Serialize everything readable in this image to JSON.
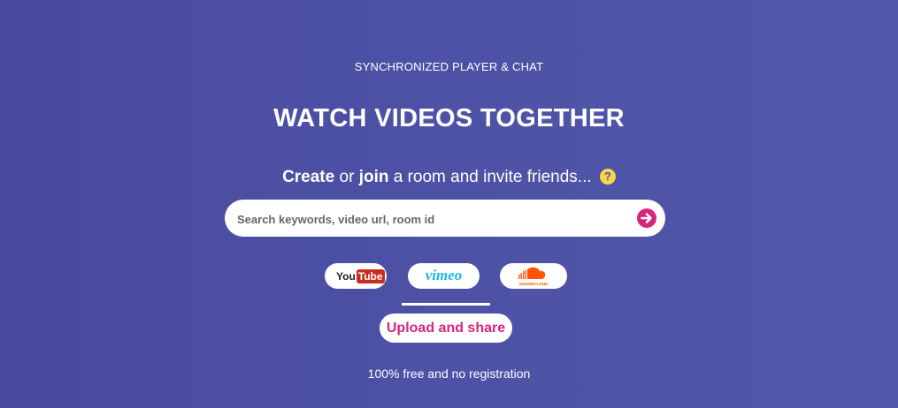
{
  "hero": {
    "eyebrow": "SYNCHRONIZED PLAYER & CHAT",
    "title": "WATCH VIDEOS TOGETHER",
    "subline": {
      "create": "Create",
      "or": "or",
      "join": "join",
      "rest": "a room and invite friends...",
      "help_glyph": "?"
    }
  },
  "search": {
    "placeholder": "Search keywords, video url, room id",
    "value": "",
    "submit_icon": "arrow-right-circle-icon"
  },
  "providers": [
    {
      "name": "youtube",
      "logo_text_you": "You",
      "logo_text_tube": "Tube"
    },
    {
      "name": "vimeo",
      "logo_text": "vimeo"
    },
    {
      "name": "soundcloud",
      "logo_text": "SOUNDCLOUD"
    }
  ],
  "upload": {
    "label": "Upload and share"
  },
  "footer": {
    "note": "100% free and no registration"
  },
  "colors": {
    "background": "#4d52a6",
    "accent_pink": "#d6267c",
    "help_yellow": "#f7d54b",
    "youtube_red": "#cc2b1f",
    "vimeo_blue": "#1ab7ea",
    "soundcloud_orange": "#ff5500"
  }
}
